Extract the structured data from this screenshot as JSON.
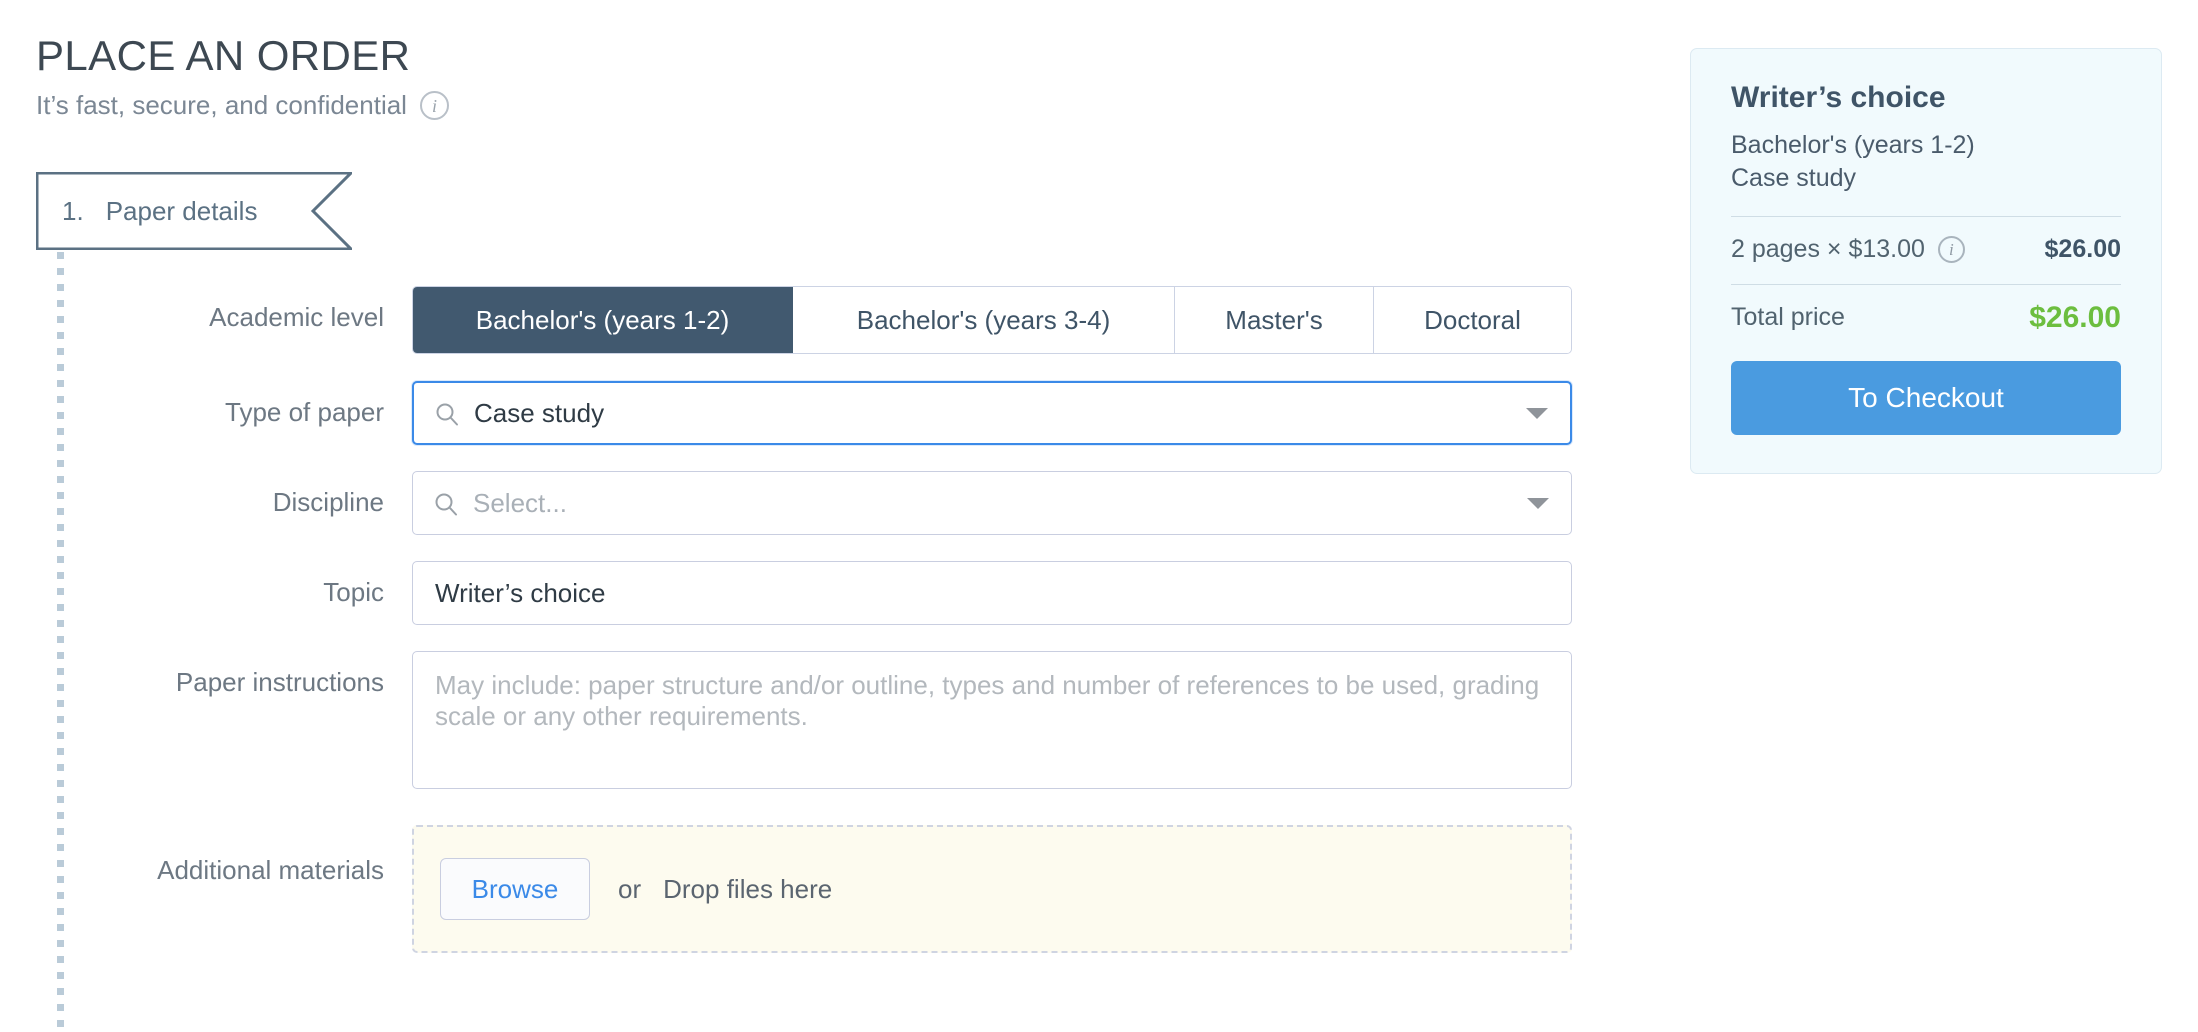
{
  "header": {
    "title": "PLACE AN ORDER",
    "subtitle": "It’s fast, secure, and confidential",
    "info_icon_glyph": "i"
  },
  "step": {
    "number": "1.",
    "label": "Paper details"
  },
  "form": {
    "academic_level": {
      "label": "Academic level",
      "options": [
        "Bachelor's (years 1-2)",
        "Bachelor's (years 3-4)",
        "Master's",
        "Doctoral"
      ],
      "selected_index": 0
    },
    "type_of_paper": {
      "label": "Type of paper",
      "value": "Case study",
      "placeholder": "Select...",
      "icon": "search-icon",
      "focused": true
    },
    "discipline": {
      "label": "Discipline",
      "value": "",
      "placeholder": "Select...",
      "icon": "search-icon",
      "focused": false
    },
    "topic": {
      "label": "Topic",
      "value": "Writer’s choice",
      "placeholder": ""
    },
    "paper_instructions": {
      "label": "Paper instructions",
      "value": "",
      "placeholder": "May include: paper structure and/or outline, types and number of references to be used, grading scale or any other requirements."
    },
    "additional_materials": {
      "label": "Additional materials",
      "browse_label": "Browse",
      "or_label": "or",
      "drop_label": "Drop files here"
    }
  },
  "summary": {
    "title": "Writer’s choice",
    "line_level": "Bachelor's (years 1-2)",
    "line_type": "Case study",
    "price_line": "2 pages × $13.00",
    "price_info_glyph": "i",
    "price_amount": "$26.00",
    "total_label": "Total price",
    "total_amount": "$26.00",
    "checkout_label": "To Checkout"
  },
  "colors": {
    "accent_blue": "#4a9be0",
    "focus_blue": "#3b8ae8",
    "slate": "#41596f",
    "total_green": "#6cbe3f",
    "dropzone_cream": "#fdfbef",
    "card_bg": "#f1fafd"
  }
}
